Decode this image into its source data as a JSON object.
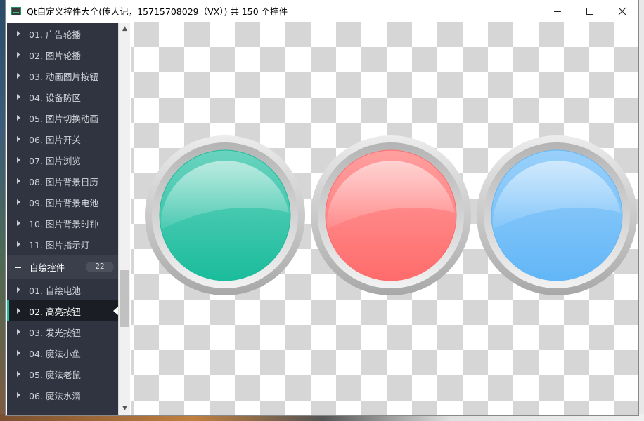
{
  "window": {
    "title": "Qt自定义控件大全(传人记，15715708029（VX）) 共 150 个控件",
    "minimize_icon": "minimize-icon",
    "maximize_icon": "maximize-icon",
    "close_icon": "close-icon"
  },
  "sidebar": {
    "items_before": [
      "01. 广告轮播",
      "02. 图片轮播",
      "03. 动画图片按钮",
      "04. 设备防区",
      "05. 图片切换动画",
      "06. 图片开关",
      "07. 图片浏览",
      "08. 图片背景日历",
      "09. 图片背景电池",
      "10. 图片背景时钟",
      "11. 图片指示灯"
    ],
    "group": {
      "label": "自绘控件",
      "count": "22"
    },
    "items_after": [
      "01. 自绘电池",
      "02. 高亮按钮",
      "03. 发光按钮",
      "04. 魔法小鱼",
      "05. 魔法老鼠",
      "06. 魔法水滴"
    ],
    "selected": "02. 高亮按钮"
  },
  "lights": [
    {
      "name": "green",
      "color": "#1abc9c"
    },
    {
      "name": "red",
      "color": "#ff6b6b"
    },
    {
      "name": "blue",
      "color": "#62b6f7"
    }
  ]
}
